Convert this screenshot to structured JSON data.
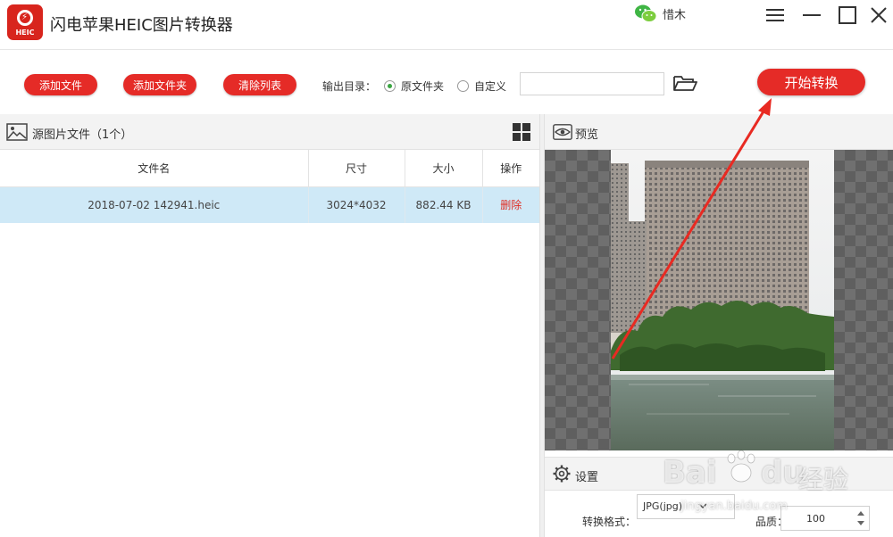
{
  "app": {
    "title": "闪电苹果HEIC图片转换器",
    "logo_text": "HEIC",
    "accent_color": "#e52b27"
  },
  "user": {
    "name": "惜木",
    "icon": "wechat-icon"
  },
  "window_controls": {
    "menu": "menu-icon",
    "minimize": "minimize-icon",
    "maximize": "maximize-icon",
    "close": "close-icon"
  },
  "toolbar": {
    "add_file_label": "添加文件",
    "add_folder_label": "添加文件夹",
    "clear_list_label": "清除列表",
    "output_dir_label": "输出目录：",
    "radio_original_label": "原文件夹",
    "radio_custom_label": "自定义",
    "output_option_selected": "原文件夹",
    "path_value": "",
    "start_label": "开始转换"
  },
  "file_panel": {
    "title": "源图片文件（1个）",
    "columns": [
      "文件名",
      "尺寸",
      "大小",
      "操作"
    ],
    "rows": [
      {
        "name": "2018-07-02 142941.heic",
        "size": "3024*4032",
        "filesize": "882.44 KB",
        "action": "删除"
      }
    ]
  },
  "preview_panel": {
    "title": "预览"
  },
  "settings": {
    "title": "设置",
    "format_label": "转换格式：",
    "format_value": "JPG(jpg)",
    "quality_label": "品质：",
    "quality_value": "100"
  },
  "watermark": {
    "brand": "Bai",
    "brand_suffix": "du",
    "text": "经验",
    "url": "jingyan.baidu.com"
  }
}
